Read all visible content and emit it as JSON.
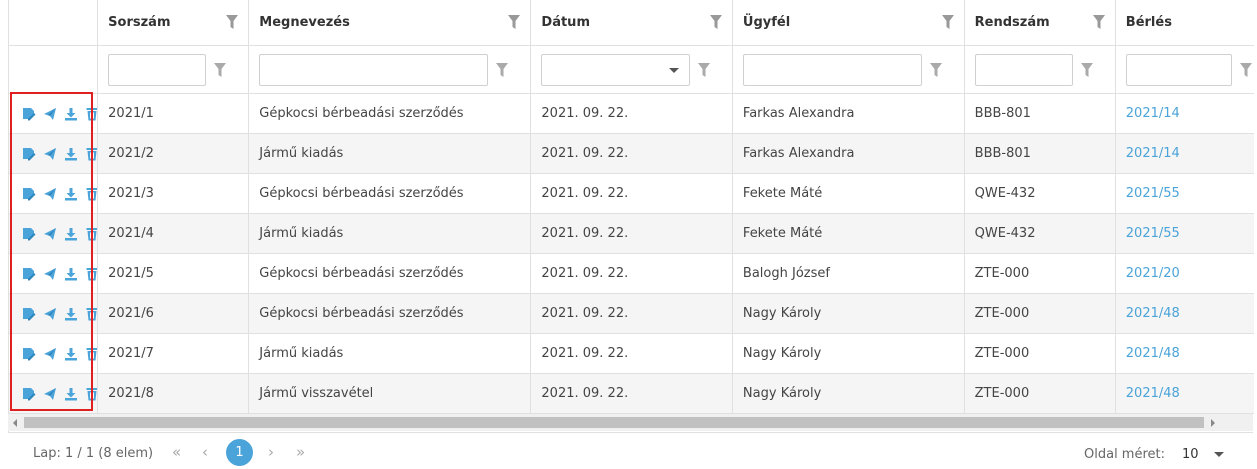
{
  "columns": [
    {
      "label": ""
    },
    {
      "label": "Sorszám"
    },
    {
      "label": "Megnevezés"
    },
    {
      "label": "Dátum"
    },
    {
      "label": "Ügyfél"
    },
    {
      "label": "Rendszám"
    },
    {
      "label": "Bérlés"
    }
  ],
  "row_actions": [
    "edit-document-icon",
    "send-icon",
    "download-icon",
    "delete-icon"
  ],
  "rows": [
    {
      "sorszam": "2021/1",
      "megnevezes": "Gépkocsi bérbeadási szerződés",
      "datum": "2021. 09. 22.",
      "ugyfel": "Farkas Alexandra",
      "rendszam": "BBB-801",
      "berles": "2021/14"
    },
    {
      "sorszam": "2021/2",
      "megnevezes": "Jármű kiadás",
      "datum": "2021. 09. 22.",
      "ugyfel": "Farkas Alexandra",
      "rendszam": "BBB-801",
      "berles": "2021/14"
    },
    {
      "sorszam": "2021/3",
      "megnevezes": "Gépkocsi bérbeadási szerződés",
      "datum": "2021. 09. 22.",
      "ugyfel": "Fekete Máté",
      "rendszam": "QWE-432",
      "berles": "2021/55"
    },
    {
      "sorszam": "2021/4",
      "megnevezes": "Jármű kiadás",
      "datum": "2021. 09. 22.",
      "ugyfel": "Fekete Máté",
      "rendszam": "QWE-432",
      "berles": "2021/55"
    },
    {
      "sorszam": "2021/5",
      "megnevezes": "Gépkocsi bérbeadási szerződés",
      "datum": "2021. 09. 22.",
      "ugyfel": "Balogh József",
      "rendszam": "ZTE-000",
      "berles": "2021/20"
    },
    {
      "sorszam": "2021/6",
      "megnevezes": "Gépkocsi bérbeadási szerződés",
      "datum": "2021. 09. 22.",
      "ugyfel": "Nagy Károly",
      "rendszam": "ZTE-000",
      "berles": "2021/48"
    },
    {
      "sorszam": "2021/7",
      "megnevezes": "Jármű kiadás",
      "datum": "2021. 09. 22.",
      "ugyfel": "Nagy Károly",
      "rendszam": "ZTE-000",
      "berles": "2021/48"
    },
    {
      "sorszam": "2021/8",
      "megnevezes": "Jármű visszavétel",
      "datum": "2021. 09. 22.",
      "ugyfel": "Nagy Károly",
      "rendszam": "ZTE-000",
      "berles": "2021/48"
    }
  ],
  "pager": {
    "info": "Lap: 1 / 1 (8 elem)",
    "first": "«",
    "prev": "‹",
    "current": "1",
    "next": "›",
    "last": "»",
    "page_size_label": "Oldal méret:",
    "page_size": "10"
  },
  "colors": {
    "accent": "#4aa3d9",
    "highlight_box": "#e02020",
    "alt_row": "#f5f5f5"
  }
}
